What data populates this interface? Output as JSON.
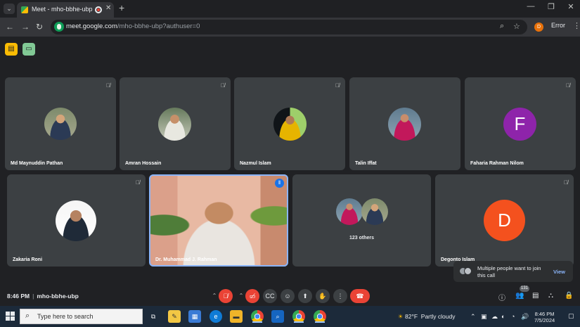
{
  "browser": {
    "tab_title": "Meet - mho-bbhe-ubp",
    "tab_close": "✕",
    "new_tab": "+",
    "url_host": "meet.google.com",
    "url_path": "/mho-bbhe-ubp?authuser=0",
    "profile_initial": "D",
    "error_label": "Error",
    "window_minimize": "—",
    "window_restore": "❐",
    "window_close": "✕"
  },
  "participants": [
    {
      "name": "Md Maynuddin Pathan",
      "avatar": "photo"
    },
    {
      "name": "Amran Hossain",
      "avatar": "photo"
    },
    {
      "name": "Nazmul Islam",
      "avatar": "photo"
    },
    {
      "name": "Talin Iffat",
      "avatar": "photo"
    },
    {
      "name": "Faharia Rahman Nilom",
      "avatar": "letter",
      "letter": "F",
      "color": "#8e24aa"
    },
    {
      "name": "Zakaria Roni",
      "avatar": "photo"
    },
    {
      "name": "Dr. Muhammad J. Rahman",
      "avatar": "video"
    },
    {
      "name": "123 others",
      "avatar": "group"
    },
    {
      "name": "Degonto Islam",
      "avatar": "letter",
      "letter": "D",
      "color": "#f4511e"
    }
  ],
  "meeting": {
    "time": "8:46 PM",
    "code": "mho-bbhe-ubp",
    "people_count": "131"
  },
  "toast": {
    "text": "Multiple people want to join this call",
    "action": "View"
  },
  "taskbar": {
    "search_placeholder": "Type here to search",
    "weather_temp": "82°F",
    "weather_desc": "Partly cloudy",
    "time": "8:46 PM",
    "date": "7/5/2024"
  },
  "colors": {
    "accent_red": "#ea4335",
    "accent_blue": "#8ab4f8",
    "tile_bg": "#3c4043"
  }
}
